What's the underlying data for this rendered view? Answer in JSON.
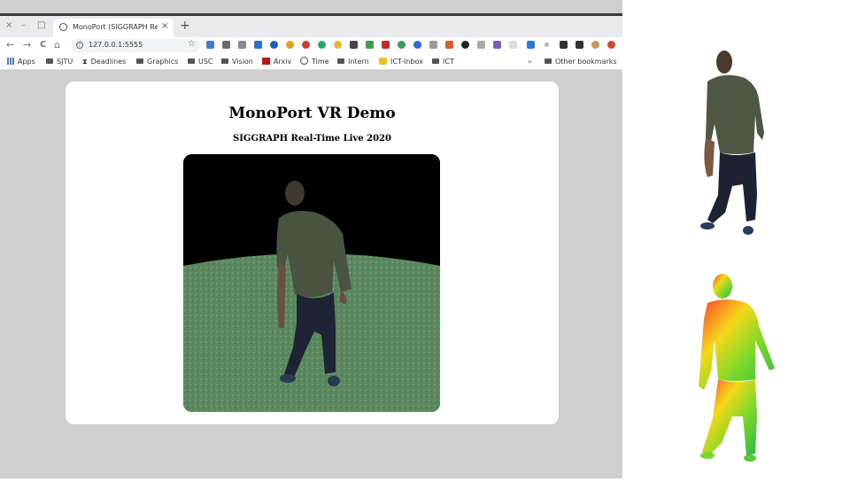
{
  "window": {
    "min_glyph": "–",
    "restore_glyph": "□",
    "close_glyph": "×"
  },
  "tab": {
    "title": "MonoPort (SIGGRAPH Re...",
    "close_glyph": "×",
    "new_tab_glyph": "+"
  },
  "nav": {
    "back": "←",
    "forward": "→",
    "reload": "C",
    "home": "⌂"
  },
  "omnibox": {
    "url": "127.0.0.1:5555",
    "info_glyph": "i",
    "star_glyph": "☆"
  },
  "bookmarks": {
    "apps": "Apps",
    "items": [
      "SJTU",
      "Deadlines",
      "Graphics",
      "USC",
      "Vision",
      "Arxiv",
      "Time",
      "Intern",
      "ICT-Inbox",
      "ICT"
    ],
    "overflow": "»",
    "other": "Other bookmarks"
  },
  "page": {
    "title": "MonoPort VR Demo",
    "subtitle": "SIGGRAPH Real-Time Live 2020"
  },
  "icons": [
    "info-icon",
    "star-icon",
    "apps-grid-icon",
    "folder-icon",
    "hourglass-icon",
    "globe-icon",
    "arxiv-icon",
    "mail-icon",
    "avatar-icon"
  ],
  "colors": {
    "page_bg": "#cfcfcf",
    "card_bg": "#ffffff",
    "ground": "#5f8a62",
    "shirt": "#4a5240",
    "pants": "#1e2433"
  }
}
